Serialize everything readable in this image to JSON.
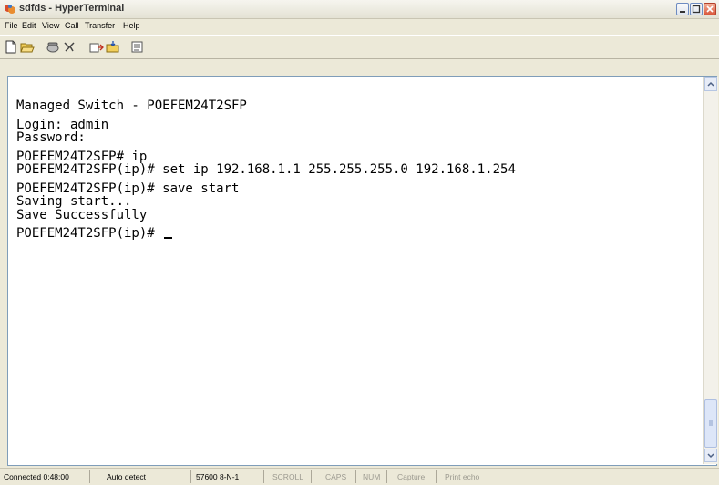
{
  "window": {
    "title": "sdfds - HyperTerminal"
  },
  "menu": {
    "items": [
      "File",
      "Edit",
      "View",
      "Call",
      "Transfer",
      "Help"
    ]
  },
  "toolbar": {
    "buttons": [
      "new-icon",
      "open-icon",
      "call-icon",
      "disconnect-icon",
      "send-icon",
      "receive-icon",
      "properties-icon"
    ]
  },
  "terminal": {
    "lines": [
      "Managed Switch - POEFEM24T2SFP",
      "Login: admin",
      "Password:",
      "POEFEM24T2SFP# ip",
      "POEFEM24T2SFP(ip)# set ip 192.168.1.1 255.255.255.0 192.168.1.254",
      "POEFEM24T2SFP(ip)# save start",
      "Saving start...",
      "Save Successfully",
      "POEFEM24T2SFP(ip)# "
    ]
  },
  "status": {
    "connected": "Connected 0:48:00",
    "detect": "Auto detect",
    "settings": "57600 8-N-1",
    "scroll": "SCROLL",
    "caps": "CAPS",
    "num": "NUM",
    "capture": "Capture",
    "print_echo": "Print echo"
  },
  "colors": {
    "accent": "#3a6ea5",
    "close_button": "#d9563b"
  }
}
